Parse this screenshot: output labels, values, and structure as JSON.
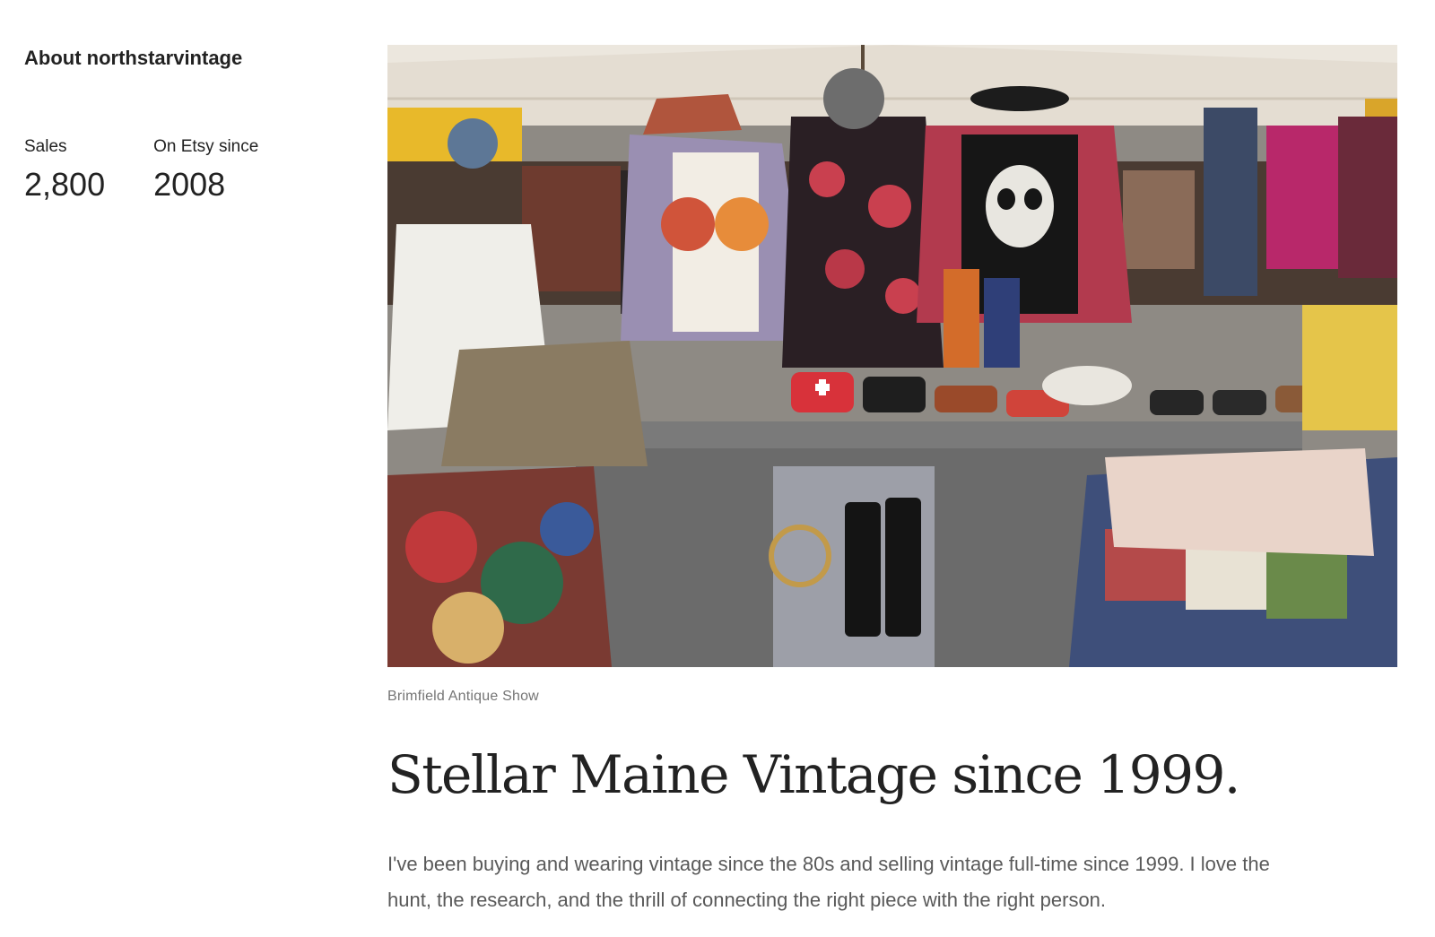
{
  "sidebar": {
    "about_title": "About northstarvintage",
    "stats": [
      {
        "label": "Sales",
        "value": "2,800"
      },
      {
        "label": "On Etsy since",
        "value": "2008"
      }
    ]
  },
  "main": {
    "photo": {
      "icon": "shop-photo-vintage-booth"
    },
    "caption": "Brimfield Antique Show",
    "headline": "Stellar Maine Vintage since 1999.",
    "bio": "I've been buying and wearing vintage since the 80s and selling vintage full-time since 1999. I love the hunt, the research, and the thrill of connecting the right piece with the right person."
  }
}
